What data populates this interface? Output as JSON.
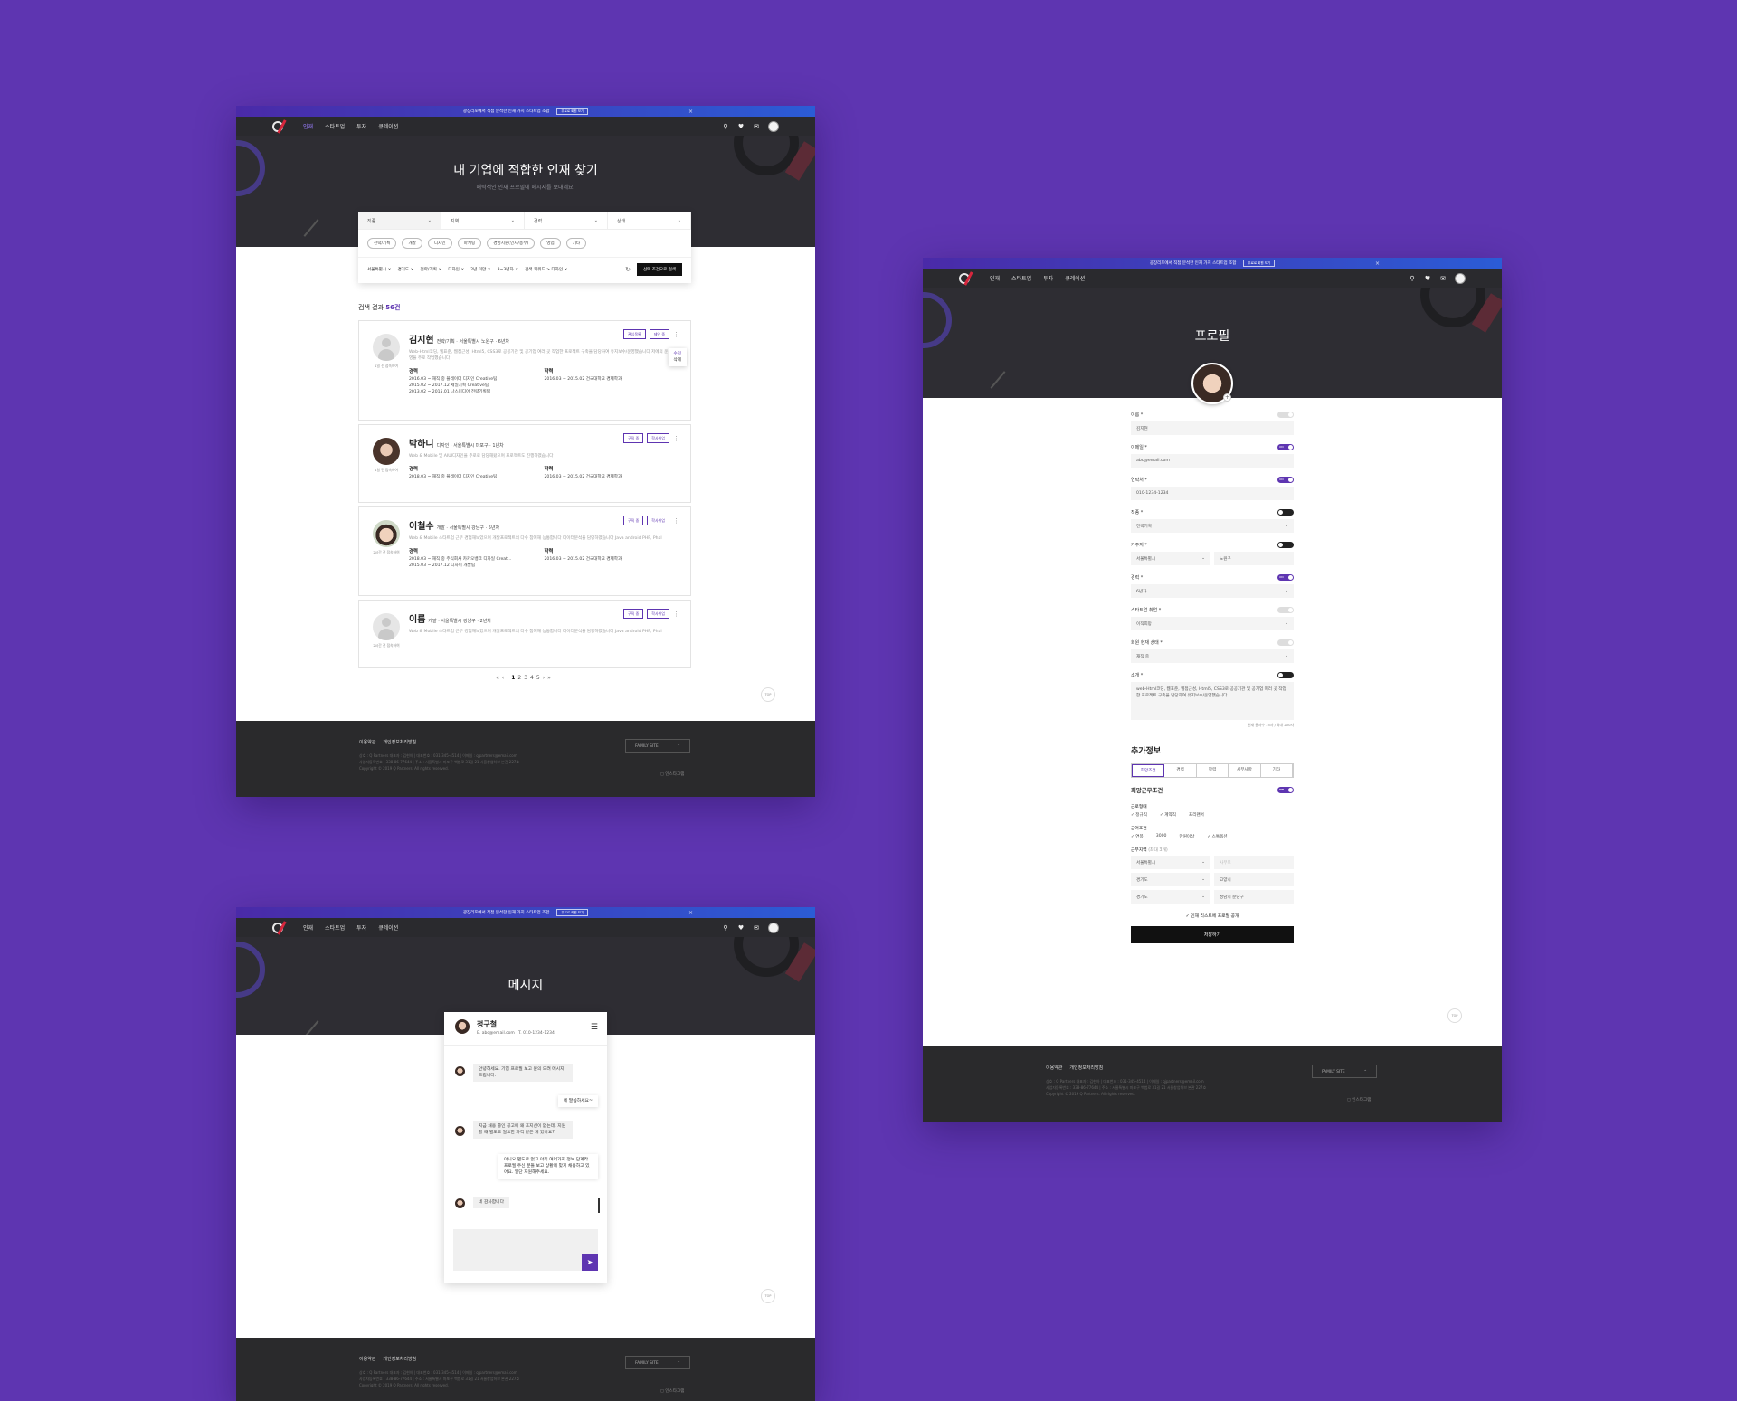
{
  "common": {
    "banner": "광장리포에서 직접 분석한 인재 가치 스타트업 조합",
    "banner_btn": "무료로 회원 보기",
    "banner_close": "×",
    "nav": [
      "인재",
      "스타트업",
      "투자",
      "큐레이션"
    ],
    "top": "TOP",
    "footer": {
      "link1": "이용약관",
      "link2": "개인정보처리방침",
      "info1": "상호 : Q Partners 대표자 : 김현아  |  대표번호 : 031-345-4514  |  이메일 : qjpartners@email.com",
      "info2": "사업자등록번호 : 338-86-77644  |  주소 : 서울특별시 마포구 백범로 31길 21 서울창업허브 본관 227호",
      "copy": "Copyright © 2019 Q Partners. All rights reserved.",
      "family": "FAMILY SITE",
      "insta": "인스타그램"
    },
    "colors": {
      "accent": "#5e35b1",
      "bg": "#5e35b1",
      "dark": "#2a2a2c"
    }
  },
  "search": {
    "title": "내 기업에 적합한 인재 찾기",
    "subtitle": "매력적인 인재 프로필에 메시지를 보내세요.",
    "filters": [
      "직종",
      "지역",
      "경력",
      "상태"
    ],
    "chips": [
      "전략/기획",
      "개발",
      "디자인",
      "마케팅",
      "경영지원(인사/총무)",
      "영업",
      "기타"
    ],
    "tags": [
      "서울특별시 ×",
      "경기도 ×",
      "전략/기획 ×",
      "디자인 ×",
      "2년 미만 ×",
      "3~3년차 ×",
      "검색 키워드 > 디자인 ×"
    ],
    "search_btn": "선택 조건으로 검색",
    "result_label": "검색 결과",
    "result_count": "56건",
    "candidates": [
      {
        "name": "김지현",
        "meta": "전략/기획 · 서울특별시 노원구 · 6년차",
        "desc": "Web-Html코딩, 웹표준, 웹접근성, Html5, CSS3로 공공기관 및 공기업 여러 곳 작업한 프로젝트 구축을 담당하여 유지보수/운영했습니다 저에의 운영을 주로 작업했습니다",
        "btn1": "관심목록",
        "btn2": "제안 중",
        "caption": "1일 전 접속하여",
        "edu": "2016.03 ~ 2015.02  건국대학교 경제학과",
        "career": [
          "2016.03 ~ 재직 중  플레이더 디자인 Creative팀",
          "2015.02 ~ 2017.12  제일기획 Creative팀",
          "2013.02 ~ 2015.01  나스미디어 전략기획팀"
        ],
        "menu": [
          "수정",
          "삭제"
        ]
      },
      {
        "name": "박하니",
        "meta": "디자인 · 서울특별시 마포구 · 1년차",
        "desc": "Web & Mobile 및 AIUI디자인을 주로로 담당해왔으며 프로젝트도 진행하였습니다",
        "btn1": "구직 중",
        "btn2": "학사취업",
        "caption": "1일 전 접속하여",
        "edu": "2016.03 ~ 2015.02  건국대학교 경제학과",
        "career": [
          "2018.03 ~ 재직 중  플레이더 디자인 Creative팀"
        ]
      },
      {
        "name": "이철수",
        "meta": "개발 · 서울특별시 강남구 · 5년차",
        "desc": "Web & Mobile 스타트업 근무 경험해보았으며 개발프로젝트의 다수 참여해 능통합니다 데이터분석을 담당하였습니다 Java android PHP, Phal",
        "btn1": "구직 중",
        "btn2": "학사취업",
        "caption": "2시간 전 접속하여",
        "edu": "2016.03 ~ 2015.02  건국대학교 경제학과",
        "career": [
          "2018.03 ~ 재직 중  주식회사 카카오뱅크 디자일 Creat...",
          "2015.03 ~ 2017.12  디자이 개발팀"
        ]
      },
      {
        "name": "이름",
        "meta": "개발 · 서울특별시 강남구 · 2년차",
        "desc": "Web & Mobile 스타트업 근무 경험해보았으며 개발프로젝트의 다수 참여해 능통합니다 데이터분석을 담당하였습니다 Java android PHP, Phal",
        "btn1": "구직 중",
        "btn2": "학사취업",
        "caption": "2시간 전 접속하여"
      }
    ],
    "edu_label": "학력",
    "career_label": "경력",
    "pager": [
      "«",
      "‹",
      "1",
      "2",
      "3",
      "4",
      "5",
      "›",
      "»"
    ]
  },
  "profile": {
    "title": "프로필",
    "fields": [
      {
        "label": "이름 *",
        "value": "김지현",
        "switch": "off"
      },
      {
        "label": "이메일 *",
        "value": "abc@email.com",
        "switch": "on"
      },
      {
        "label": "연락처 *",
        "value": "010-1234-1234",
        "switch": "on"
      },
      {
        "label": "직종 *",
        "value": "전략기획",
        "switch": "dark"
      },
      {
        "label": "거주지 *",
        "value": "서울특별시",
        "value2": "노원구",
        "switch": "dark"
      },
      {
        "label": "경력 *",
        "value": "6년차",
        "switch": "on"
      },
      {
        "label": "스타트업 취업 *",
        "value": "이직희망",
        "switch": "off"
      },
      {
        "label": "회원 현재 상태 *",
        "value": "재직 중",
        "switch": "off"
      },
      {
        "label": "소개 *",
        "value": "web-Html코딩, 웹표준, 웹접근성, Html5, CSS3로 공공기관 및 공기업 여러 곳 작업한 프로젝트 구축을 담당하여 유지보수/운영했습니다.",
        "switch": "dark"
      }
    ],
    "intro_count": "현재 글자수 75자 / 최대 200자",
    "extra_title": "추가정보",
    "tabs": [
      "희망조건",
      "경력",
      "학력",
      "세부사항",
      "기타"
    ],
    "work_title": "희망근무조건",
    "work_type_label": "근로형태",
    "work_types": [
      "✓ 정규직",
      "✓ 계약직",
      "프리랜서"
    ],
    "salary_label": "급여조건",
    "salary": [
      "✓ 연봉",
      "3000",
      "만원이상",
      "✓ 스톡옵션"
    ],
    "region_label": "근무지역",
    "region_note": "(최대 3개)",
    "regions": [
      [
        "서울특별시",
        "사무모"
      ],
      [
        "경기도",
        "고양시"
      ],
      [
        "경기도",
        "성남시 분당구"
      ]
    ],
    "public_label": "✓ 인재 리스트에 프로필 공개",
    "save_btn": "저장하기"
  },
  "message": {
    "title": "메시지",
    "person": "정구철",
    "email": "E. abc@email.com",
    "phone": "T. 010-1234-1234",
    "msgs": [
      {
        "side": "l",
        "text": "안녕하세요. 기업 프로필 보고 문의 드려 메시지 드립니다."
      },
      {
        "side": "r",
        "text": "네 말씀하세요~"
      },
      {
        "side": "l",
        "text": "지금 채용 중인 공고에 왜 포지션이 없는데, 지원할 때 별도로 필요한 자격 같은 게 있나요?"
      },
      {
        "side": "r",
        "text": "아니요 별도로 없고 아직 여러가지 정보 단계라 프로필 주신 분들 보고 상황에 맞게 채용하고 있어요. 일단 지원해주세요."
      },
      {
        "side": "l",
        "text": "네 감사합니다"
      }
    ],
    "send_icon": "send-icon"
  }
}
